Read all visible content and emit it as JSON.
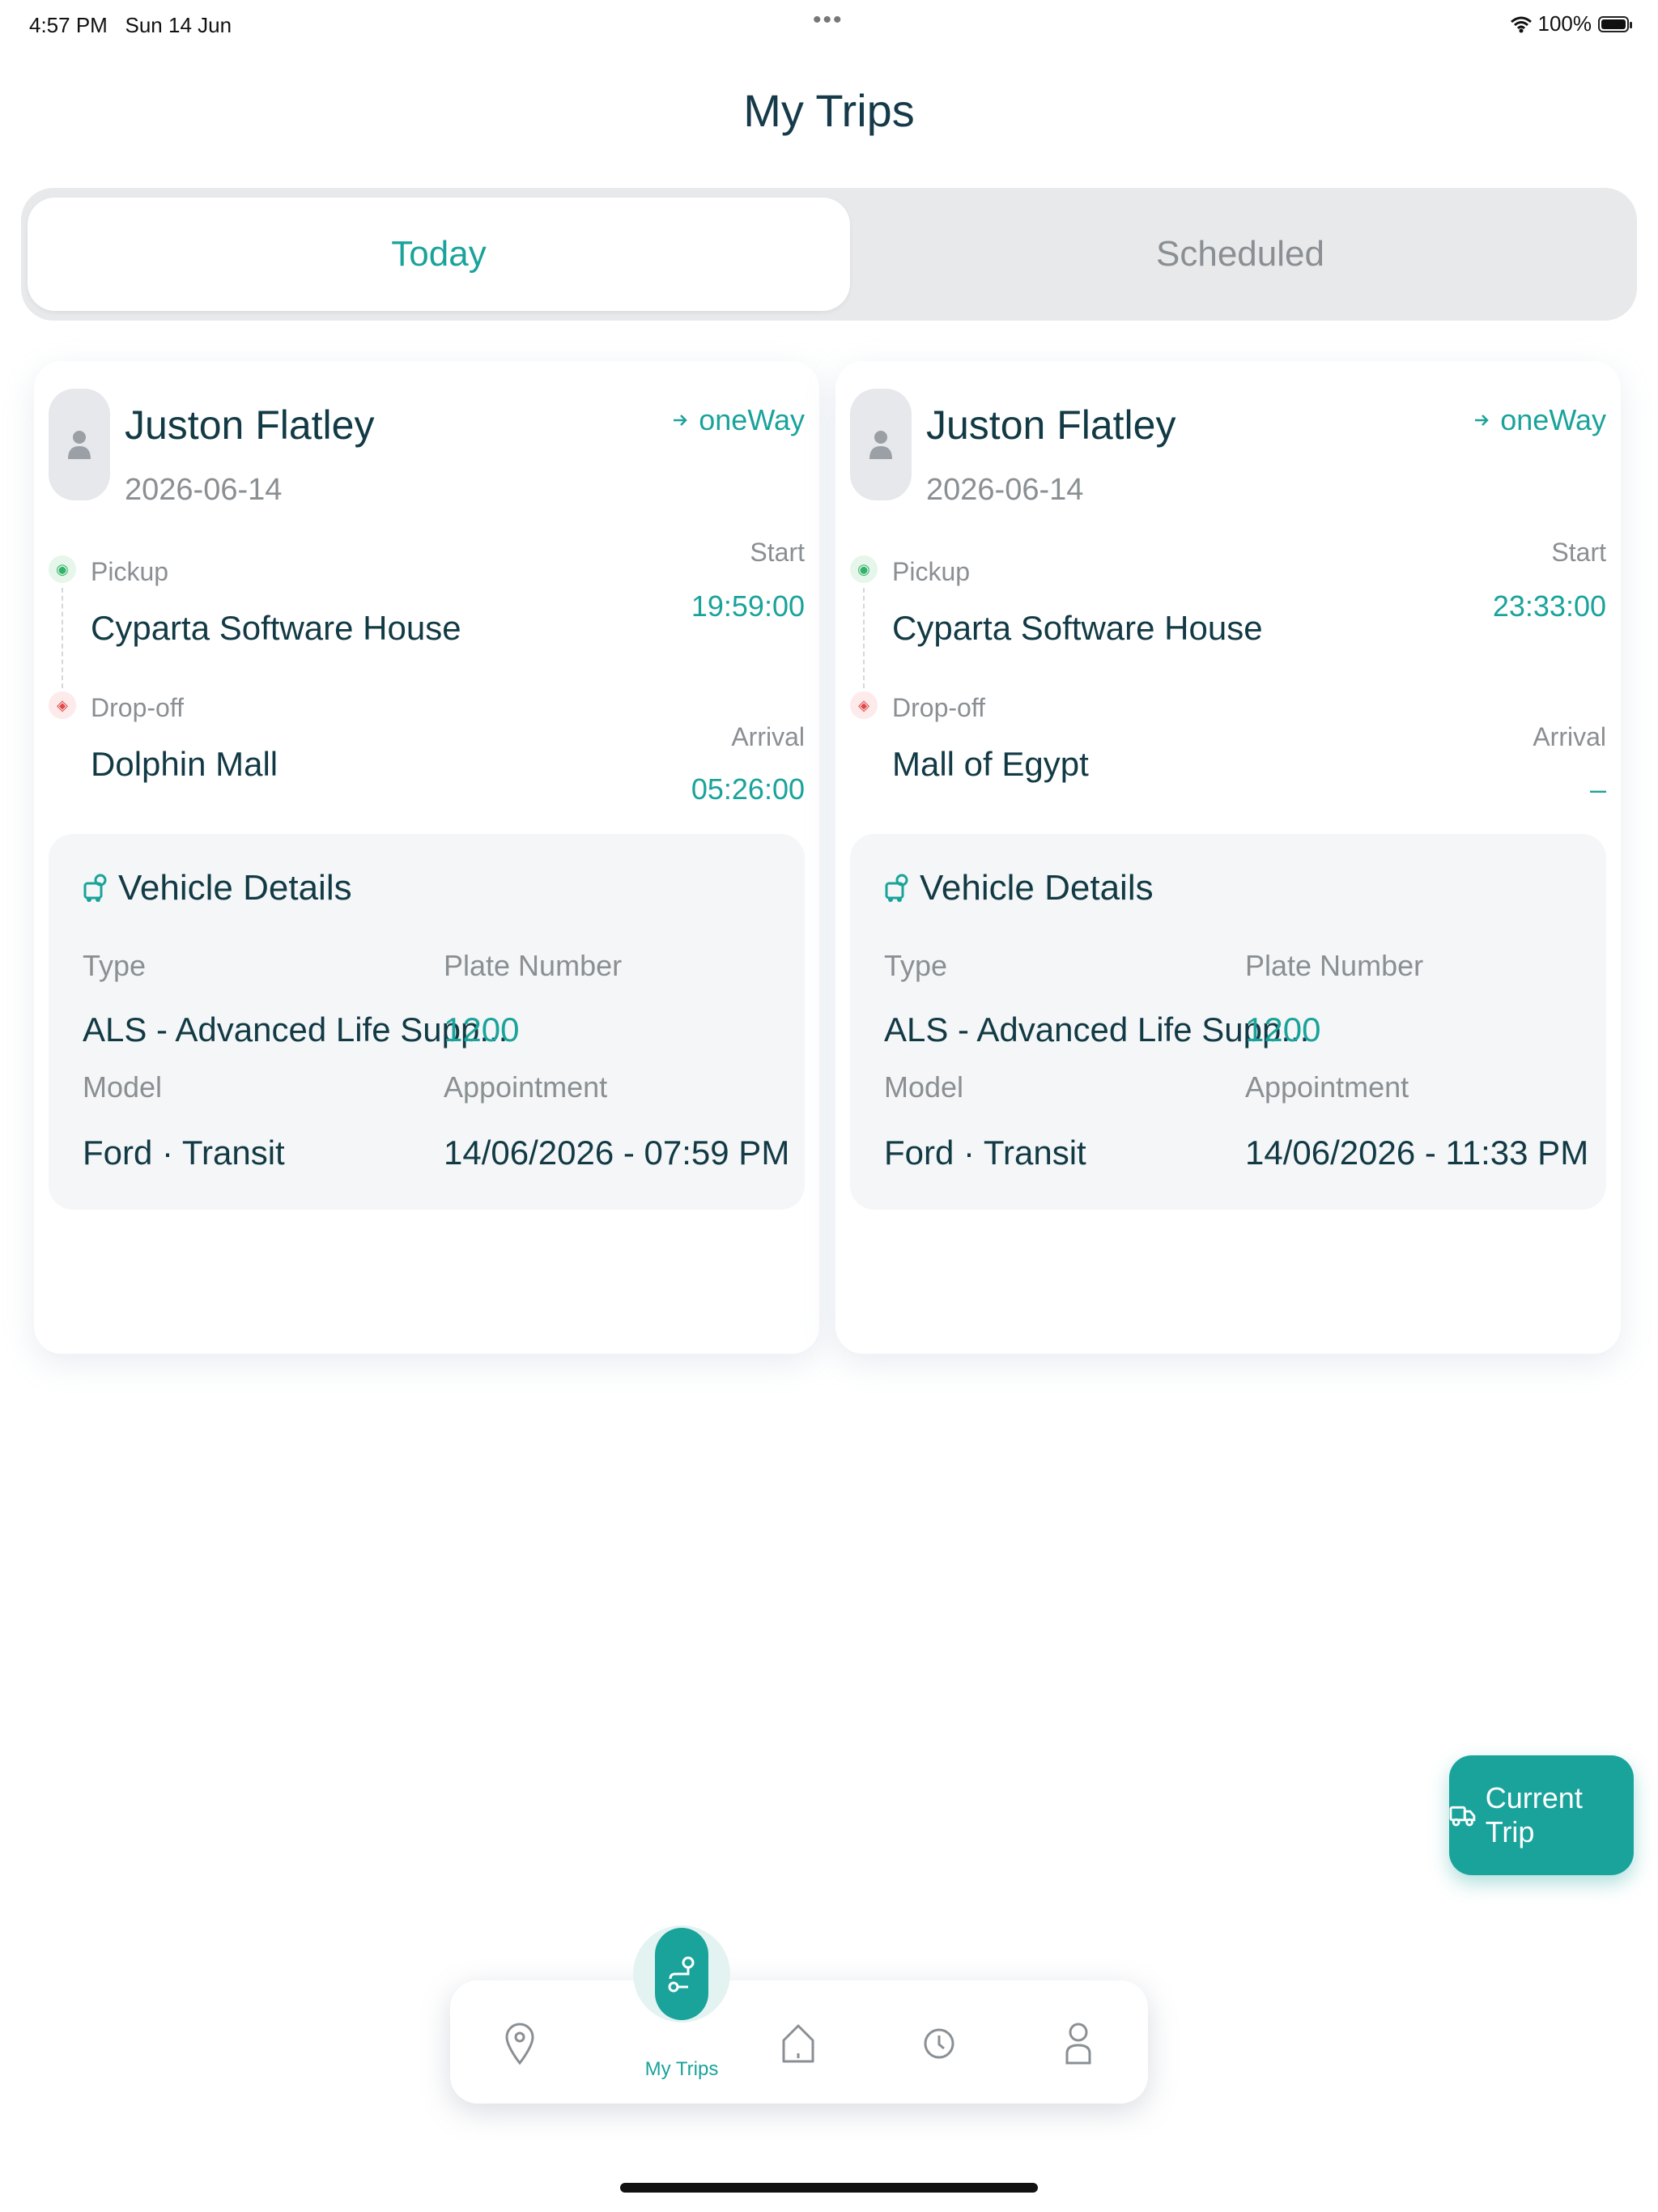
{
  "status_bar": {
    "time": "4:57 PM",
    "date": "Sun 14 Jun",
    "battery": "100%"
  },
  "page": {
    "title": "My Trips"
  },
  "tabs": [
    {
      "label": "Today",
      "active": true
    },
    {
      "label": "Scheduled",
      "active": false
    }
  ],
  "trips": [
    {
      "name": "Juston Flatley",
      "date": "2026-06-14",
      "trip_type": "oneWay",
      "pickup_label": "Pickup",
      "pickup": "Cyparta Software House",
      "dropoff_label": "Drop-off",
      "dropoff": "Dolphin Mall",
      "start_label": "Start",
      "start_time": "19:59:00",
      "arrival_label": "Arrival",
      "arrival_time": "05:26:00",
      "vehicle": {
        "title": "Vehicle Details",
        "type_label": "Type",
        "type": "ALS - Advanced Life Supp...",
        "plate_label": "Plate Number",
        "plate": "1200",
        "model_label": "Model",
        "model": "Ford · Transit",
        "appointment_label": "Appointment",
        "appointment": "14/06/2026 - 07:59 PM"
      }
    },
    {
      "name": "Juston Flatley",
      "date": "2026-06-14",
      "trip_type": "oneWay",
      "pickup_label": "Pickup",
      "pickup": "Cyparta Software House",
      "dropoff_label": "Drop-off",
      "dropoff": "Mall of Egypt",
      "start_label": "Start",
      "start_time": "23:33:00",
      "arrival_label": "Arrival",
      "arrival_time": "–",
      "vehicle": {
        "title": "Vehicle Details",
        "type_label": "Type",
        "type": "ALS - Advanced Life Supp...",
        "plate_label": "Plate Number",
        "plate": "1200",
        "model_label": "Model",
        "model": "Ford · Transit",
        "appointment_label": "Appointment",
        "appointment": "14/06/2026 - 11:33 PM"
      }
    }
  ],
  "current_trip_button": {
    "label": "Current Trip"
  },
  "bottom_nav": {
    "active_label": "My Trips"
  },
  "colors": {
    "accent": "#1aa39b",
    "title": "#153a4a",
    "muted": "#8a8f93"
  }
}
